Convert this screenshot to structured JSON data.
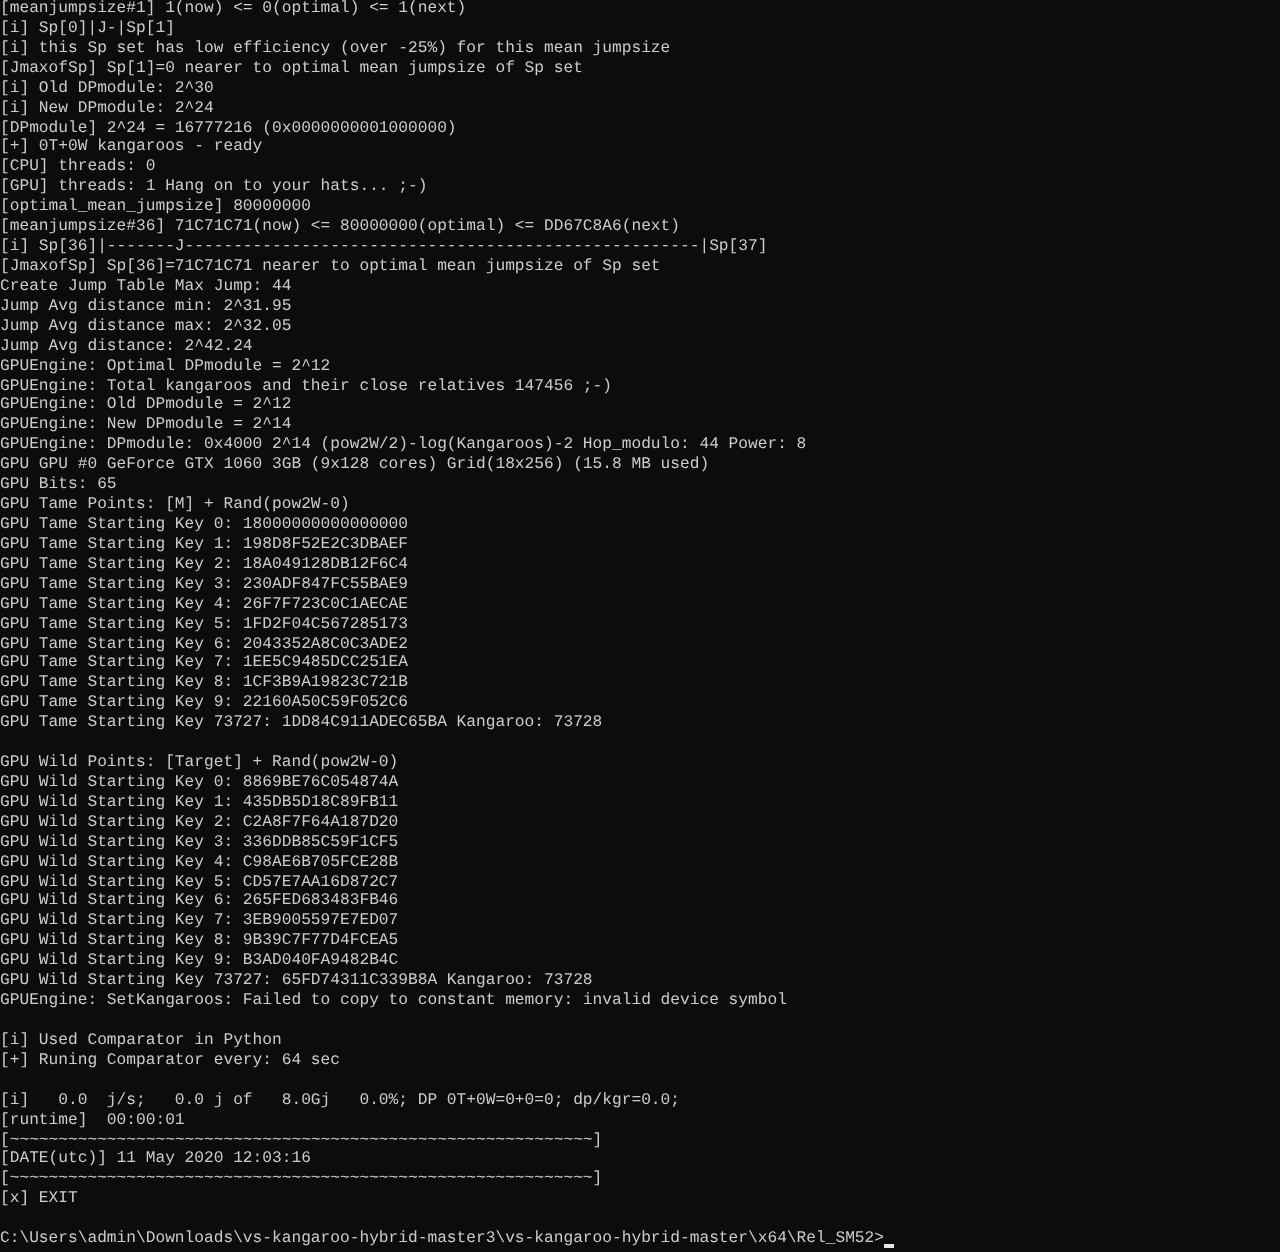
{
  "terminal": {
    "blocks": [
      {
        "lines": [
          "[meanjumpsize#1] 1(now) <= 0(optimal) <= 1(next)",
          "[i] Sp[0]|J-|Sp[1]",
          "[i] this Sp set has low efficiency (over -25%) for this mean jumpsize",
          "[JmaxofSp] Sp[1]=0 nearer to optimal mean jumpsize of Sp set",
          "[i] Old DPmodule: 2^30",
          "[i] New DPmodule: 2^24",
          "[DPmodule] 2^24 = 16777216 (0x0000000001000000)",
          "[+] 0T+0W kangaroos - ready",
          "[CPU] threads: 0",
          "[GPU] threads: 1 Hang on to your hats... ;-)",
          "[optimal_mean_jumpsize] 80000000",
          "[meanjumpsize#36] 71C71C71(now) <= 80000000(optimal) <= DD67C8A6(next)",
          "[i] Sp[36]|-------J-----------------------------------------------------|Sp[37]",
          "[JmaxofSp] Sp[36]=71C71C71 nearer to optimal mean jumpsize of Sp set",
          "Create Jump Table Max Jump: 44",
          "Jump Avg distance min: 2^31.95",
          "Jump Avg distance max: 2^32.05",
          "Jump Avg distance: 2^42.24",
          "GPUEngine: Optimal DPmodule = 2^12",
          "GPUEngine: Total kangaroos and their close relatives 147456 ;-)",
          "GPUEngine: Old DPmodule = 2^12",
          "GPUEngine: New DPmodule = 2^14",
          "GPUEngine: DPmodule: 0x4000 2^14 (pow2W/2)-log(Kangaroos)-2 Hop_modulo: 44 Power: 8",
          "GPU GPU #0 GeForce GTX 1060 3GB (9x128 cores) Grid(18x256) (15.8 MB used)",
          "GPU Bits: 65",
          "GPU Tame Points: [M] + Rand(pow2W-0)",
          "GPU Tame Starting Key 0: 18000000000000000",
          "GPU Tame Starting Key 1: 198D8F52E2C3DBAEF",
          "GPU Tame Starting Key 2: 18A049128DB12F6C4",
          "GPU Tame Starting Key 3: 230ADF847FC55BAE9",
          "GPU Tame Starting Key 4: 26F7F723C0C1AECAE",
          "GPU Tame Starting Key 5: 1FD2F04C567285173",
          "GPU Tame Starting Key 6: 2043352A8C0C3ADE2",
          "GPU Tame Starting Key 7: 1EE5C9485DCC251EA",
          "GPU Tame Starting Key 8: 1CF3B9A19823C721B",
          "GPU Tame Starting Key 9: 22160A50C59F052C6",
          "GPU Tame Starting Key 73727: 1DD84C911ADEC65BA Kangaroo: 73728"
        ]
      },
      {
        "lines": [
          "GPU Wild Points: [Target] + Rand(pow2W-0)",
          "GPU Wild Starting Key 0: 8869BE76C054874A",
          "GPU Wild Starting Key 1: 435DB5D18C89FB11",
          "GPU Wild Starting Key 2: C2A8F7F64A187D20",
          "GPU Wild Starting Key 3: 336DDB85C59F1CF5",
          "GPU Wild Starting Key 4: C98AE6B705FCE28B",
          "GPU Wild Starting Key 5: CD57E7AA16D872C7",
          "GPU Wild Starting Key 6: 265FED683483FB46",
          "GPU Wild Starting Key 7: 3EB9005597E7ED07",
          "GPU Wild Starting Key 8: 9B39C7F77D4FCEA5",
          "GPU Wild Starting Key 9: B3AD040FA9482B4C",
          "GPU Wild Starting Key 73727: 65FD74311C339B8A Kangaroo: 73728",
          "GPUEngine: SetKangaroos: Failed to copy to constant memory: invalid device symbol"
        ]
      },
      {
        "lines": [
          "[i] Used Comparator in Python",
          "[+] Runing Comparator every: 64 sec"
        ]
      },
      {
        "lines": [
          "[i]   0.0  j/s;   0.0 j of   8.0Gj   0.0%; DP 0T+0W=0+0=0; dp/kgr=0.0;",
          "[runtime]  00:00:01",
          "[~~~~~~~~~~~~~~~~~~~~~~~~~~~~~~~~~~~~~~~~~~~~~~~~~~~~~~~~~~~~]",
          "[DATE(utc)] 11 May 2020 12:03:16",
          "[~~~~~~~~~~~~~~~~~~~~~~~~~~~~~~~~~~~~~~~~~~~~~~~~~~~~~~~~~~~~]",
          "[x] EXIT"
        ]
      }
    ],
    "prompt": "C:\\Users\\admin\\Downloads\\vs-kangaroo-hybrid-master3\\vs-kangaroo-hybrid-master\\x64\\Rel_SM52>"
  }
}
